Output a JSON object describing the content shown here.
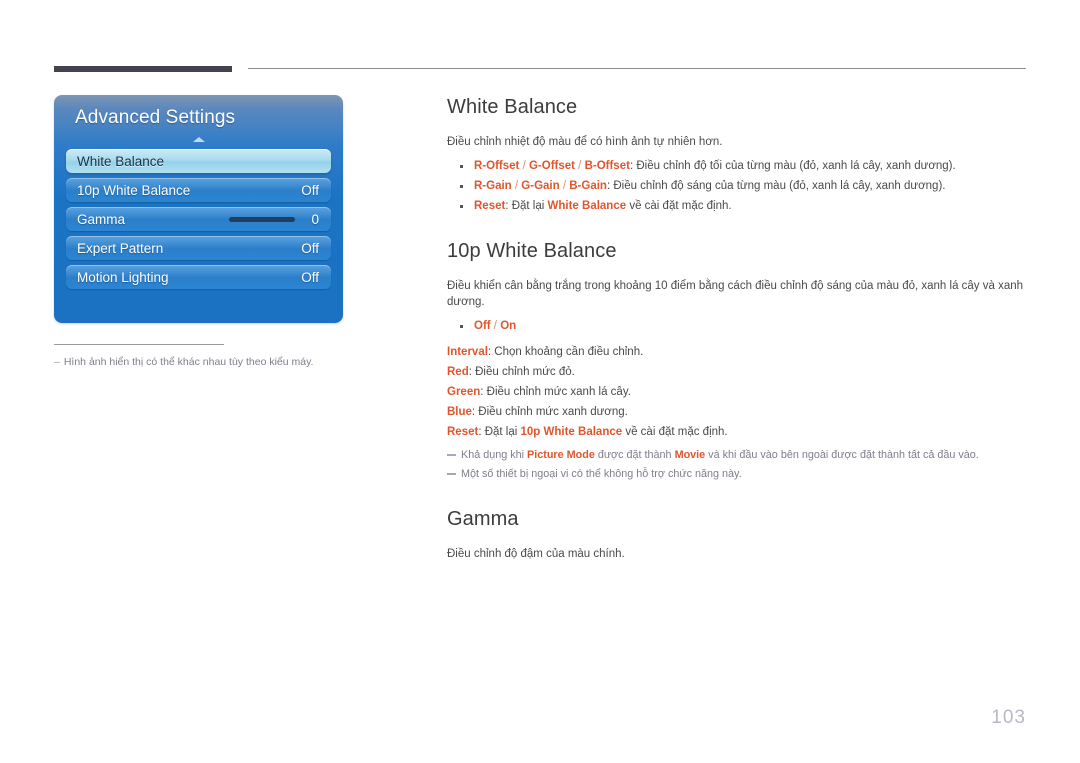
{
  "page": {
    "number": "103"
  },
  "osd": {
    "title": "Advanced Settings",
    "rows": [
      {
        "label": "White Balance",
        "value": "",
        "selected": true,
        "slider": null
      },
      {
        "label": "10p White Balance",
        "value": "Off",
        "selected": false,
        "slider": null
      },
      {
        "label": "Gamma",
        "value": "0",
        "selected": false,
        "slider": 46
      },
      {
        "label": "Expert Pattern",
        "value": "Off",
        "selected": false,
        "slider": null
      },
      {
        "label": "Motion Lighting",
        "value": "Off",
        "selected": false,
        "slider": null
      }
    ]
  },
  "left_footnote": {
    "dash": "–",
    "text": "Hình ảnh hiển thị có thể khác nhau tùy theo kiểu máy."
  },
  "sections": {
    "white_balance": {
      "title": "White Balance",
      "intro": "Điều chỉnh nhiệt độ màu để có hình ảnh tự nhiên hơn.",
      "bullets": [
        {
          "kw1": "R-Offset",
          "s1": " / ",
          "kw2": "G-Offset",
          "s2": " / ",
          "kw3": "B-Offset",
          "rest": ": Điều chỉnh độ tối của từng màu (đỏ, xanh lá cây, xanh dương)."
        },
        {
          "kw1": "R-Gain",
          "s1": " / ",
          "kw2": "G-Gain",
          "s2": " / ",
          "kw3": "B-Gain",
          "rest": ": Điều chỉnh độ sáng của từng màu (đỏ, xanh lá cây, xanh dương)."
        }
      ],
      "reset_bullet": {
        "kw1": "Reset",
        "mid": ": Đặt lại ",
        "kw2": "White Balance",
        "rest": " về cài đặt mặc định."
      }
    },
    "tenp_white_balance": {
      "title": "10p White Balance",
      "intro": "Điều khiển cân bằng trắng trong khoảng 10 điểm bằng cách điều chỉnh độ sáng của màu đỏ, xanh lá cây và xanh dương.",
      "onoff_bullet": {
        "off": "Off",
        "sep": " / ",
        "on": "On"
      },
      "defs": [
        {
          "kw": "Interval",
          "rest": ": Chọn khoảng cần điều chỉnh."
        },
        {
          "kw": "Red",
          "rest": ": Điều chỉnh mức đỏ."
        },
        {
          "kw": "Green",
          "rest": ": Điều chỉnh mức xanh lá cây."
        },
        {
          "kw": "Blue",
          "rest": ": Điều chỉnh mức xanh dương."
        }
      ],
      "reset_def": {
        "kw1": "Reset",
        "mid": ": Đặt lại ",
        "kw2": "10p White Balance",
        "rest": " về cài đặt mặc định."
      },
      "notes": [
        {
          "pre": "Khả dụng khi ",
          "kw1": "Picture Mode",
          "mid": " được đặt thành ",
          "kw2": "Movie",
          "rest": " và khi đầu vào bên ngoài được đặt thành tất cả đầu vào."
        },
        {
          "pre": "Một số thiết bị ngoại vi có thể không hỗ trợ chức năng này.",
          "kw1": "",
          "mid": "",
          "kw2": "",
          "rest": ""
        }
      ]
    },
    "gamma": {
      "title": "Gamma",
      "intro": "Điều chỉnh độ đậm của màu chính."
    }
  }
}
